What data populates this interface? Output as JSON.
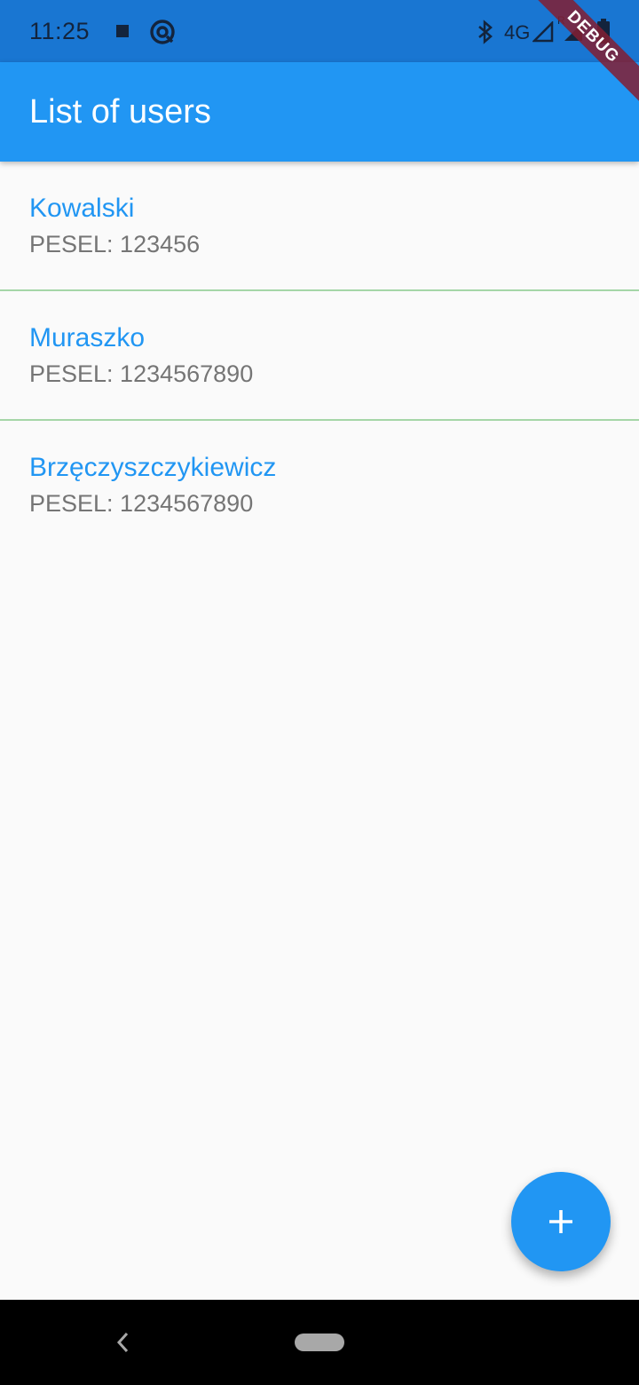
{
  "status_bar": {
    "time": "11:25",
    "network": "4G",
    "roaming": "R",
    "icons": [
      "stop-square-icon",
      "at-sign-icon",
      "bluetooth-icon",
      "signal-icon",
      "battery-icon"
    ]
  },
  "debug_banner": "DEBUG",
  "app_bar": {
    "title": "List of users"
  },
  "users": [
    {
      "name": "Kowalski",
      "pesel": "PESEL: 123456"
    },
    {
      "name": "Muraszko",
      "pesel": "PESEL: 1234567890"
    },
    {
      "name": "Brzęczyszczykiewicz",
      "pesel": "PESEL: 1234567890"
    }
  ],
  "fab": {
    "icon": "plus-icon"
  },
  "nav_bar": {
    "icons": [
      "back-icon",
      "home-pill-icon"
    ]
  },
  "colors": {
    "primary": "#2196f3",
    "status_bar": "#1976d2",
    "divider": "#a5d6a7",
    "secondary_text": "#757575",
    "background": "#fafafa"
  }
}
